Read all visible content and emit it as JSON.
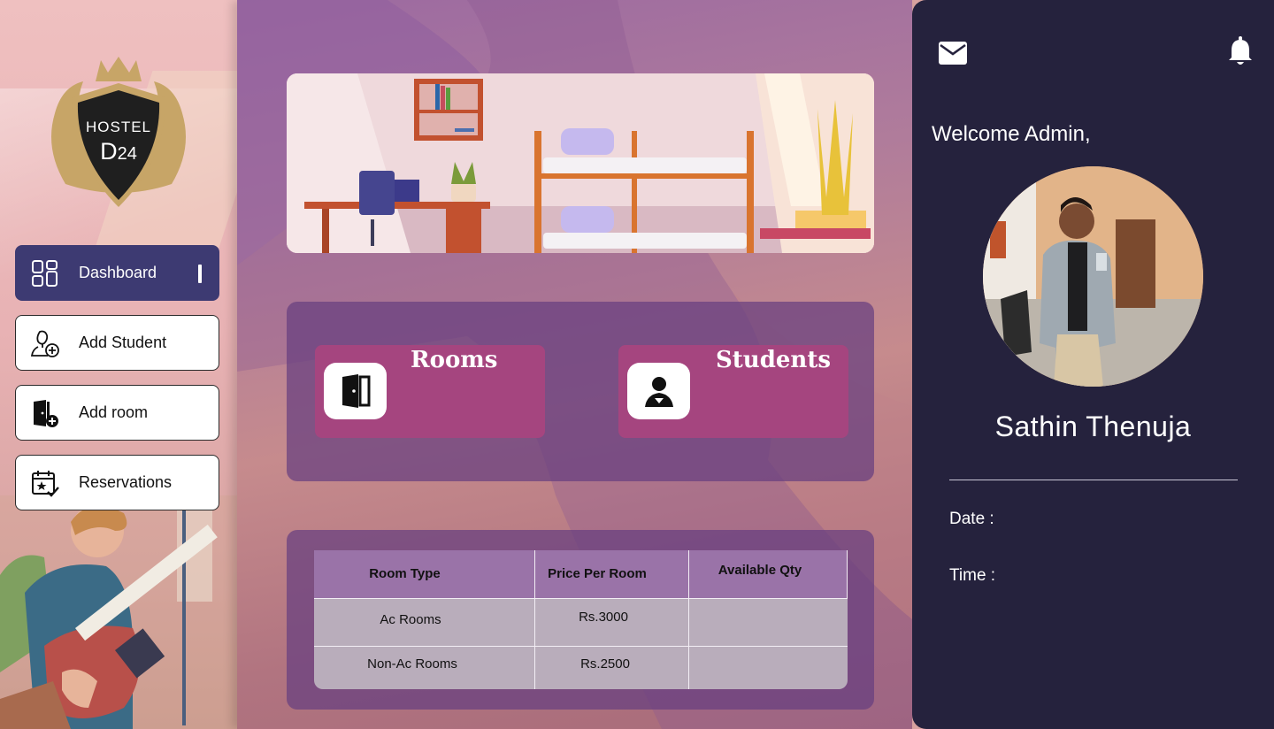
{
  "logo": {
    "line1": "HOSTEL",
    "line2": "D",
    "line2_sub": "24"
  },
  "sidebar": {
    "items": [
      {
        "label": "Dashboard",
        "icon": "dashboard-grid-icon",
        "active": true
      },
      {
        "label": "Add Student",
        "icon": "add-student-icon",
        "active": false
      },
      {
        "label": "Add room",
        "icon": "add-room-icon",
        "active": false
      },
      {
        "label": "Reservations",
        "icon": "calendar-star-icon",
        "active": false
      }
    ]
  },
  "cards": [
    {
      "title": "Rooms",
      "icon": "door-icon"
    },
    {
      "title": "Students",
      "icon": "student-icon"
    }
  ],
  "table": {
    "headers": [
      "Room Type",
      "Price Per Room",
      "Available Qty"
    ],
    "rows": [
      [
        "Ac Rooms",
        "Rs.3000",
        ""
      ],
      [
        "Non-Ac Rooms",
        "Rs.2500",
        ""
      ]
    ]
  },
  "right_panel": {
    "welcome": "Welcome Admin,",
    "user_name": "Sathin Thenuja",
    "date_label": "Date :",
    "time_label": "Time :"
  },
  "colors": {
    "sidebar_active": "#3d3a72",
    "card_bg": "#a5457f",
    "panel_bg": "#25223d",
    "table_header": "#9a73a8"
  }
}
